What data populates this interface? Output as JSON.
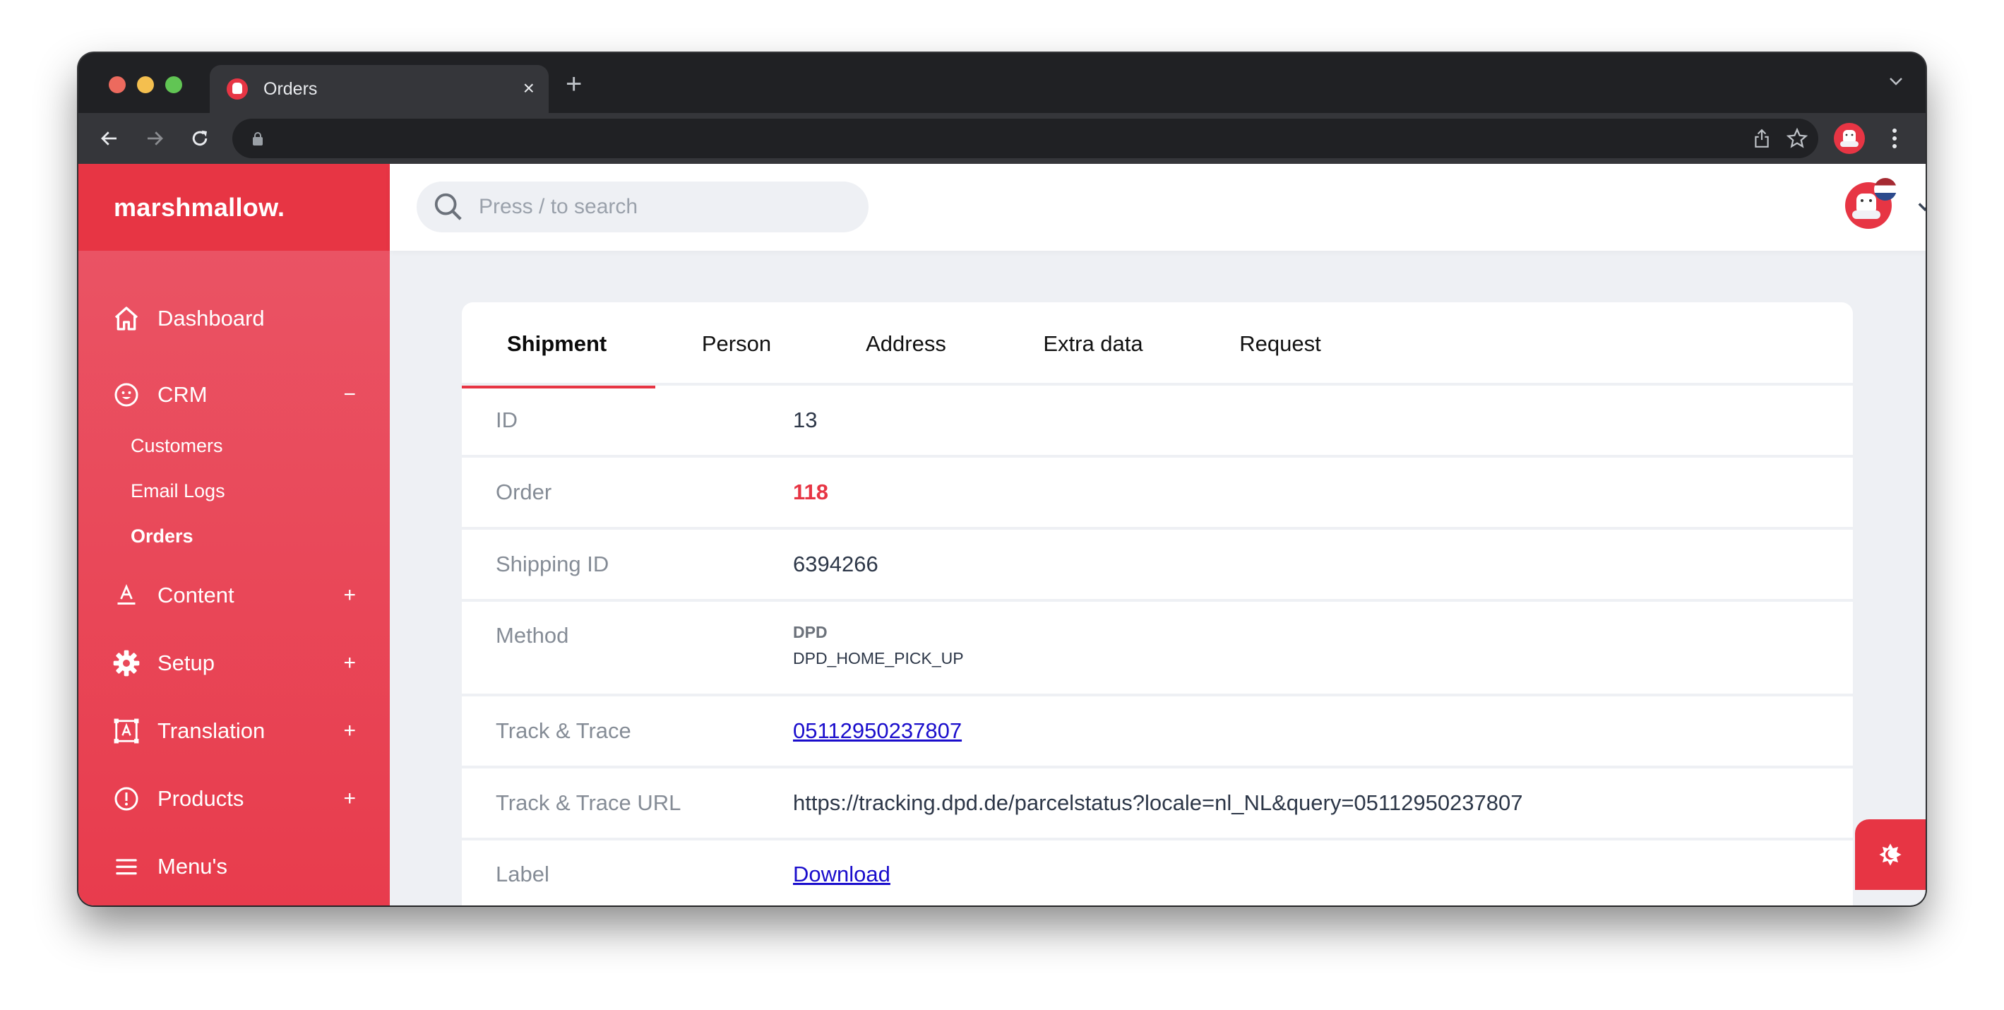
{
  "browser": {
    "tab_title": "Orders",
    "address_url": "",
    "icons": {
      "back": "arrow-left-icon",
      "forward": "arrow-right-icon",
      "reload": "reload-icon",
      "lock": "lock-icon",
      "share": "share-icon",
      "bookmark": "star-icon",
      "profile": "profile-avatar",
      "menu": "kebab-menu-icon",
      "tab_search": "chevron-down-icon",
      "new_tab": "+",
      "close_tab": "×"
    }
  },
  "app": {
    "brand": "marshmallow.",
    "accent_color": "#e73544",
    "search": {
      "placeholder": "Press / to search"
    },
    "sidebar": {
      "items": [
        {
          "label": "Dashboard",
          "icon": "home-icon",
          "toggle": ""
        },
        {
          "label": "CRM",
          "icon": "smiley-icon",
          "toggle": "−",
          "expanded": true,
          "children": [
            {
              "label": "Customers",
              "active": false
            },
            {
              "label": "Email Logs",
              "active": false
            },
            {
              "label": "Orders",
              "active": true
            }
          ]
        },
        {
          "label": "Content",
          "icon": "text-format-icon",
          "toggle": "+"
        },
        {
          "label": "Setup",
          "icon": "gear-icon",
          "toggle": "+"
        },
        {
          "label": "Translation",
          "icon": "translate-icon",
          "toggle": "+"
        },
        {
          "label": "Products",
          "icon": "alert-circle-icon",
          "toggle": "+"
        },
        {
          "label": "Menu's",
          "icon": "hamburger-icon",
          "toggle": ""
        }
      ]
    },
    "user": {
      "language_flag": "NL"
    }
  },
  "card": {
    "tabs": [
      {
        "label": "Shipment",
        "active": true
      },
      {
        "label": "Person",
        "active": false
      },
      {
        "label": "Address",
        "active": false
      },
      {
        "label": "Extra data",
        "active": false
      },
      {
        "label": "Request",
        "active": false
      }
    ],
    "rows": {
      "id": {
        "key": "ID",
        "value": "13"
      },
      "order": {
        "key": "Order",
        "value": "118"
      },
      "shipping_id": {
        "key": "Shipping ID",
        "value": "6394266"
      },
      "method": {
        "key": "Method",
        "carrier": "DPD",
        "code": "DPD_HOME_PICK_UP"
      },
      "track_trace": {
        "key": "Track & Trace",
        "value": "05112950237807"
      },
      "track_trace_url": {
        "key": "Track & Trace URL",
        "value": "https://tracking.dpd.de/parcelstatus?locale=nl_NL&query=05112950237807"
      },
      "label": {
        "key": "Label",
        "value": "Download"
      }
    }
  },
  "theme_toggle": {
    "icon": "dark-mode-icon"
  }
}
